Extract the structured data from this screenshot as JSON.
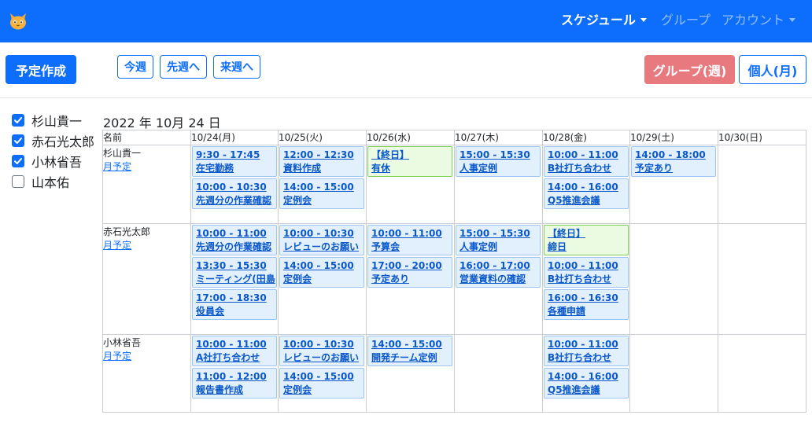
{
  "nav": {
    "schedule": "スケジュール",
    "group": "グループ",
    "account": "アカウント",
    "logo_icon": "cat-face-icon"
  },
  "toolbar": {
    "create": "予定作成",
    "this_week": "今週",
    "prev_week": "先週へ",
    "next_week": "来週へ",
    "group_week": "グループ(週)",
    "personal_month": "個人(月)"
  },
  "members": [
    {
      "name": "杉山貴一",
      "checked": true
    },
    {
      "name": "赤石光太郎",
      "checked": true
    },
    {
      "name": "小林省吾",
      "checked": true
    },
    {
      "name": "山本佑",
      "checked": false
    }
  ],
  "date_title": "2022 年 10月 24 日",
  "calendar": {
    "name_header": "名前",
    "days": [
      "10/24(月)",
      "10/25(火)",
      "10/26(水)",
      "10/27(木)",
      "10/28(金)",
      "10/29(土)",
      "10/30(日)"
    ],
    "month_link": "月予定",
    "rows": [
      {
        "user": "杉山貴一",
        "cells": [
          [
            {
              "time": "9:30 - 17:45",
              "title": "在宅勤務"
            },
            {
              "time": "10:00 - 10:30",
              "title": "先週分の作業確認"
            }
          ],
          [
            {
              "time": "12:00 - 12:30",
              "title": "資料作成"
            },
            {
              "time": "14:00 - 15:00",
              "title": "定例会"
            }
          ],
          [
            {
              "time": "【終日】",
              "title": "有休",
              "allday": true
            }
          ],
          [
            {
              "time": "15:00 - 15:30",
              "title": "人事定例"
            }
          ],
          [
            {
              "time": "10:00 - 11:00",
              "title": "B社打ち合わせ"
            },
            {
              "time": "14:00 - 16:00",
              "title": "Q5推進会議"
            }
          ],
          [
            {
              "time": "14:00 - 18:00",
              "title": "予定あり"
            }
          ],
          []
        ]
      },
      {
        "user": "赤石光太郎",
        "cells": [
          [
            {
              "time": "10:00 - 11:00",
              "title": "先週分の作業確認"
            },
            {
              "time": "13:30 - 15:30",
              "title": "ミーティング(田島"
            },
            {
              "time": "17:00 - 18:30",
              "title": "役員会"
            }
          ],
          [
            {
              "time": "10:00 - 10:30",
              "title": "レビューのお願い"
            },
            {
              "time": "14:00 - 15:00",
              "title": "定例会"
            }
          ],
          [
            {
              "time": "10:00 - 11:00",
              "title": "予算会"
            },
            {
              "time": "17:00 - 20:00",
              "title": "予定あり"
            }
          ],
          [
            {
              "time": "15:00 - 15:30",
              "title": "人事定例"
            },
            {
              "time": "16:00 - 17:00",
              "title": "営業資料の確認"
            }
          ],
          [
            {
              "time": "【終日】",
              "title": "締日",
              "allday": true
            },
            {
              "time": "10:00 - 11:00",
              "title": "B社打ち合わせ"
            },
            {
              "time": "16:00 - 16:30",
              "title": "各種申請"
            }
          ],
          [],
          []
        ]
      },
      {
        "user": "小林省吾",
        "cells": [
          [
            {
              "time": "10:00 - 11:00",
              "title": "A社打ち合わせ"
            },
            {
              "time": "11:00 - 12:00",
              "title": "報告書作成"
            }
          ],
          [
            {
              "time": "10:00 - 10:30",
              "title": "レビューのお願い"
            },
            {
              "time": "14:00 - 15:00",
              "title": "定例会"
            }
          ],
          [
            {
              "time": "14:00 - 15:00",
              "title": "開発チーム定例"
            }
          ],
          [],
          [
            {
              "time": "10:00 - 11:00",
              "title": "B社打ち合わせ"
            },
            {
              "time": "14:00 - 16:00",
              "title": "Q5推進会議"
            }
          ],
          [],
          []
        ]
      }
    ]
  }
}
